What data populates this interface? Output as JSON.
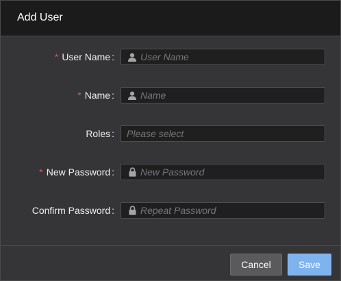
{
  "dialog": {
    "title": "Add User"
  },
  "form": {
    "fields": [
      {
        "label": "User Name",
        "required": true,
        "placeholder": "User Name",
        "icon": "user-icon"
      },
      {
        "label": "Name",
        "required": true,
        "placeholder": "Name",
        "icon": "user-icon"
      },
      {
        "label": "Roles",
        "required": false,
        "placeholder": "Please select",
        "icon": ""
      },
      {
        "label": "New Password",
        "required": true,
        "placeholder": "New Password",
        "icon": "lock-icon"
      },
      {
        "label": "Confirm Password",
        "required": false,
        "placeholder": "Repeat Password",
        "icon": "lock-icon"
      }
    ],
    "required_marker": "*",
    "label_separator": ":"
  },
  "footer": {
    "cancel_label": "Cancel",
    "save_label": "Save"
  },
  "colors": {
    "required": "#e05252",
    "primary_button": "#7fb3ee",
    "secondary_button": "#5a5a5c"
  }
}
